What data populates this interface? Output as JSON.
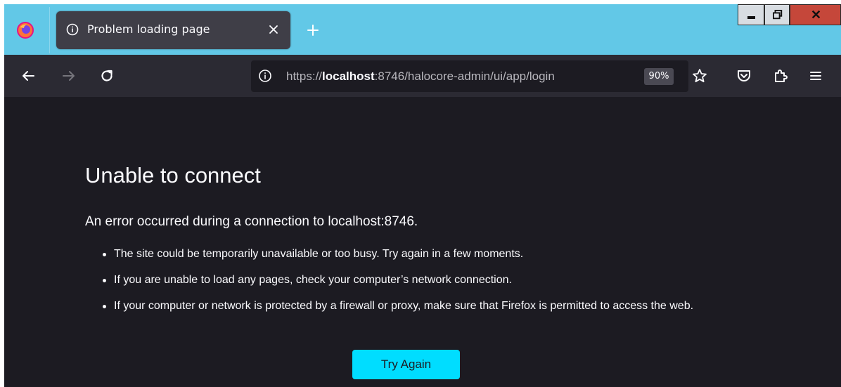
{
  "tab": {
    "title": "Problem loading page",
    "icon": "info-icon"
  },
  "toolbar": {
    "url_scheme": "https://",
    "url_host": "localhost",
    "url_rest": ":8746/halocore-admin/ui/app/login",
    "zoom": "90%"
  },
  "page": {
    "title": "Unable to connect",
    "description": "An error occurred during a connection to localhost:8746.",
    "bullets": [
      "The site could be temporarily unavailable or too busy. Try again in a few moments.",
      "If you are unable to load any pages, check your computer’s network connection.",
      "If your computer or network is protected by a firewall or proxy, make sure that Firefox is permitted to access the web."
    ],
    "try_again_label": "Try Again"
  },
  "colors": {
    "titlebar": "#62c8e7",
    "toolbar": "#2b2a33",
    "content_bg": "#1c1b22",
    "button_accent": "#00ddff",
    "close_button": "#c5473a"
  }
}
